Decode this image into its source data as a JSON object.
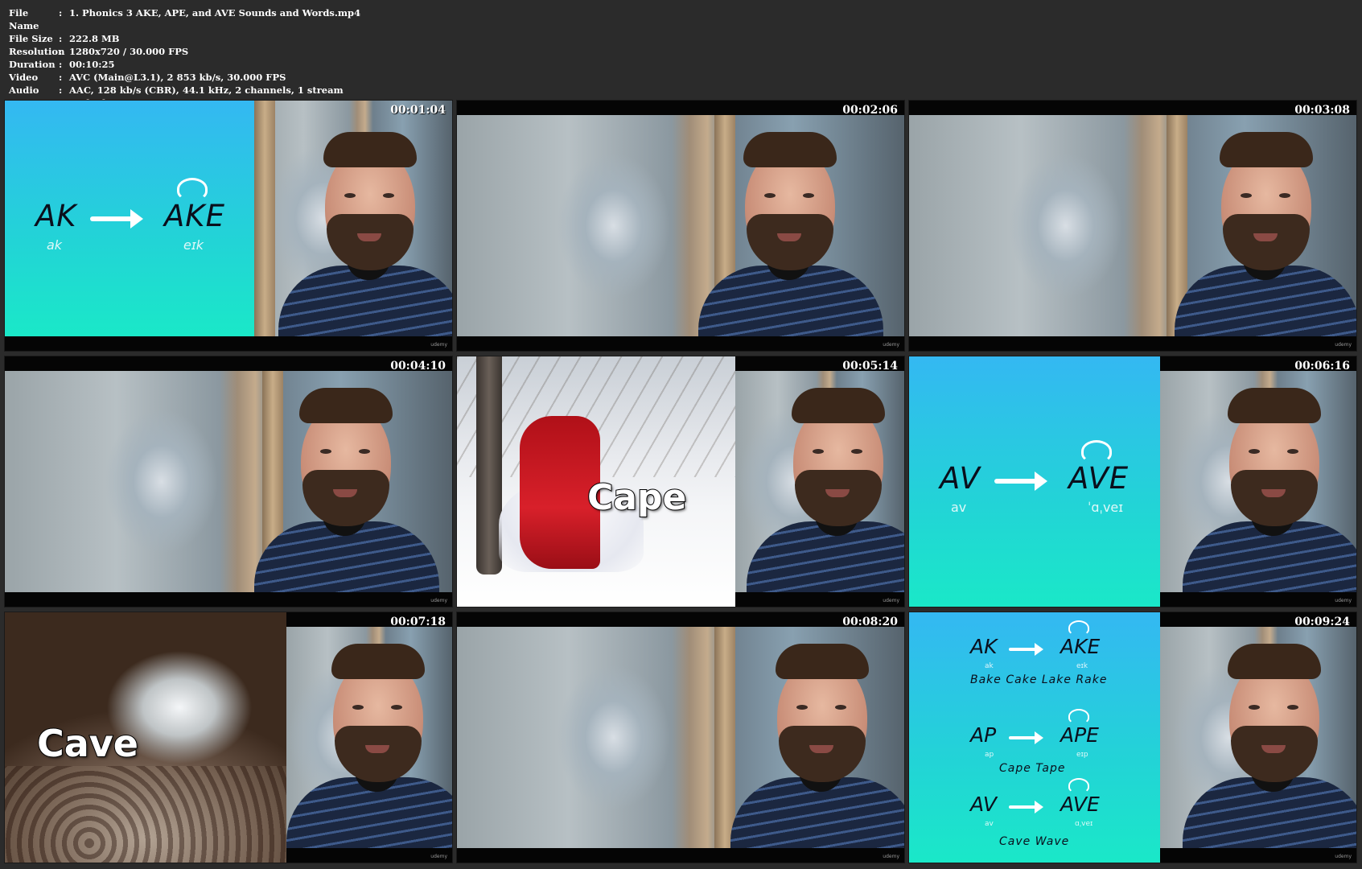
{
  "info": [
    {
      "label": "File Name",
      "value": "1. Phonics 3 AKE, APE, and AVE Sounds and Words.mp4"
    },
    {
      "label": "File Size",
      "value": "222.8 MB"
    },
    {
      "label": "Resolution",
      "value": "1280x720 / 30.000 FPS"
    },
    {
      "label": "Duration",
      "value": "00:10:25"
    },
    {
      "label": "Video",
      "value": "AVC (Main@L3.1), 2 853 kb/s, 30.000 FPS"
    },
    {
      "label": "Audio",
      "value": "AAC, 128 kb/s (CBR), 44.1 kHz, 2 channels, 1 stream"
    },
    {
      "label": "Comment",
      "value": "Orthodox"
    }
  ],
  "separator": ":",
  "timestamps": [
    "00:01:04",
    "00:02:06",
    "00:03:08",
    "00:04:10",
    "00:05:14",
    "00:06:16",
    "00:07:18",
    "00:08:20",
    "00:09:24"
  ],
  "slide1": {
    "from": "AK",
    "to": "AKE",
    "from_ipa": "ak",
    "to_ipa": "eɪk"
  },
  "slide6": {
    "from": "AV",
    "to": "AVE",
    "from_ipa": "av",
    "to_ipa": "ˈɑˌveɪ"
  },
  "snow_caption": "Cape",
  "cave_caption": "Cave",
  "summary": {
    "rows": [
      {
        "from": "AK",
        "to": "AKE",
        "from_ipa": "ak",
        "to_ipa": "eɪk",
        "words": "Bake Cake Lake Rake"
      },
      {
        "from": "AP",
        "to": "APE",
        "from_ipa": "ap",
        "to_ipa": "eɪp",
        "words": "Cape Tape"
      },
      {
        "from": "AV",
        "to": "AVE",
        "from_ipa": "av",
        "to_ipa": "ɑˌveɪ",
        "words": "Cave Wave"
      }
    ]
  },
  "watermark": "udemy"
}
